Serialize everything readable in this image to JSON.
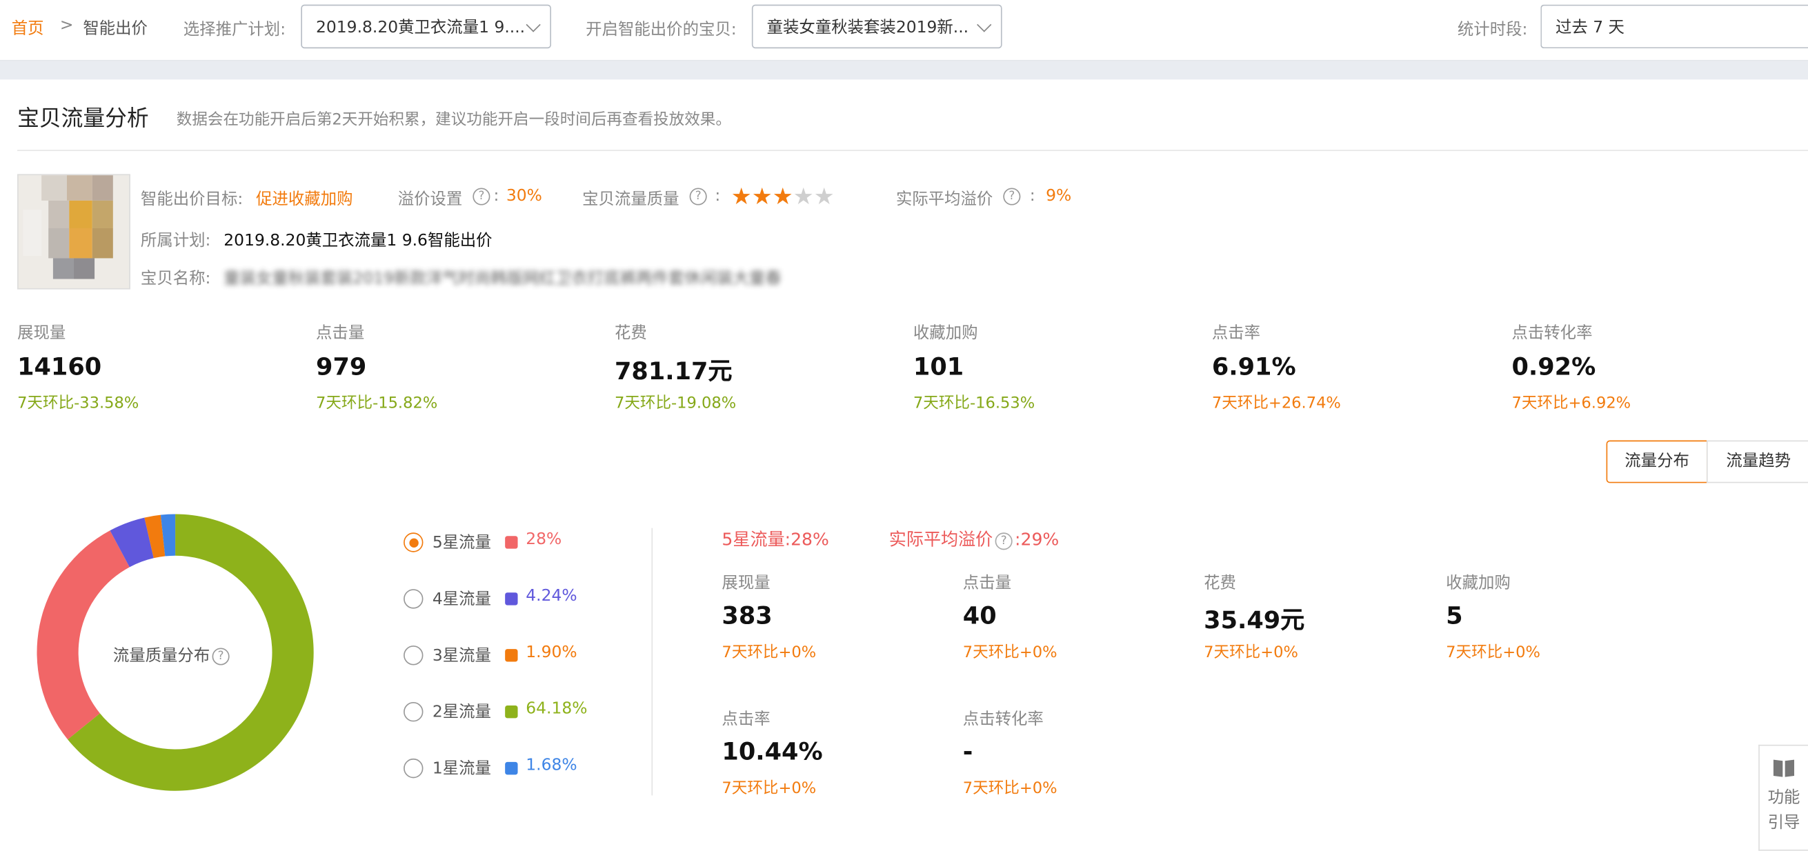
{
  "breadcrumb": {
    "home": "首页",
    "separator": ">",
    "current": "智能出价"
  },
  "filters": {
    "plan_label": "选择推广计划:",
    "plan_value": "2019.8.20黄卫衣流量1 9....",
    "item_label": "开启智能出价的宝贝:",
    "item_value": "童装女童秋装套装2019新...",
    "period_label": "统计时段:",
    "period_value": "过去 7 天"
  },
  "section": {
    "title": "宝贝流量分析",
    "note": "数据会在功能开启后第2天开始积累，建议功能开启一段时间后再查看投放效果。"
  },
  "product": {
    "goal_label": "智能出价目标:",
    "goal_value": "促进收藏加购",
    "premium_label": "溢价设置",
    "premium_value": "30%",
    "quality_label": "宝贝流量质量",
    "quality_stars": 3,
    "quality_max": 5,
    "avg_premium_label": "实际平均溢价",
    "avg_premium_value": "9%",
    "plan_label": "所属计划:",
    "plan_value": "2019.8.20黄卫衣流量1 9.6智能出价",
    "name_label": "宝贝名称:",
    "name_value": "童装女童秋装套装2019新款洋气时尚韩版网红卫衣打底裤两件套休闲装大童春"
  },
  "metrics": [
    {
      "label": "展现量",
      "value": "14160",
      "comparison": "7天环比-33.58%",
      "trend": "down"
    },
    {
      "label": "点击量",
      "value": "979",
      "comparison": "7天环比-15.82%",
      "trend": "down"
    },
    {
      "label": "花费",
      "value": "781.17元",
      "comparison": "7天环比-19.08%",
      "trend": "down"
    },
    {
      "label": "收藏加购",
      "value": "101",
      "comparison": "7天环比-16.53%",
      "trend": "down"
    },
    {
      "label": "点击率",
      "value": "6.91%",
      "comparison": "7天环比+26.74%",
      "trend": "up"
    },
    {
      "label": "点击转化率",
      "value": "0.92%",
      "comparison": "7天环比+6.92%",
      "trend": "up"
    }
  ],
  "tabs": [
    {
      "label": "流量分布",
      "active": true
    },
    {
      "label": "流量趋势",
      "active": false
    }
  ],
  "chart_data": {
    "type": "pie",
    "center_label": "流量质量分布",
    "categories": [
      "5星流量",
      "4星流量",
      "3星流量",
      "2星流量",
      "1星流量"
    ],
    "values": [
      28,
      4.24,
      1.9,
      64.18,
      1.68
    ],
    "labels": [
      "28%",
      "4.24%",
      "1.90%",
      "64.18%",
      "1.68%"
    ],
    "colors": [
      "#f16667",
      "#6058dc",
      "#f27b0e",
      "#8eb21b",
      "#3e85e6"
    ],
    "selected": 0
  },
  "detail": {
    "title": "5星流量:",
    "title_value": "28%",
    "premium_label": "实际平均溢价",
    "premium_value": "29%",
    "metrics": [
      {
        "label": "展现量",
        "value": "383",
        "comparison": "7天环比+0%"
      },
      {
        "label": "点击量",
        "value": "40",
        "comparison": "7天环比+0%"
      },
      {
        "label": "花费",
        "value": "35.49元",
        "comparison": "7天环比+0%"
      },
      {
        "label": "收藏加购",
        "value": "5",
        "comparison": "7天环比+0%"
      },
      {
        "label": "点击率",
        "value": "10.44%",
        "comparison": "7天环比+0%"
      },
      {
        "label": "点击转化率",
        "value": "-",
        "comparison": "7天环比+0%"
      }
    ]
  },
  "guide": {
    "line1": "功能",
    "line2": "引导",
    "icon": "book-icon"
  },
  "colors": {
    "accent": "#f27b0e",
    "up": "#f27b0e",
    "down": "#85a818",
    "detail_title": "#ec5a5a"
  }
}
